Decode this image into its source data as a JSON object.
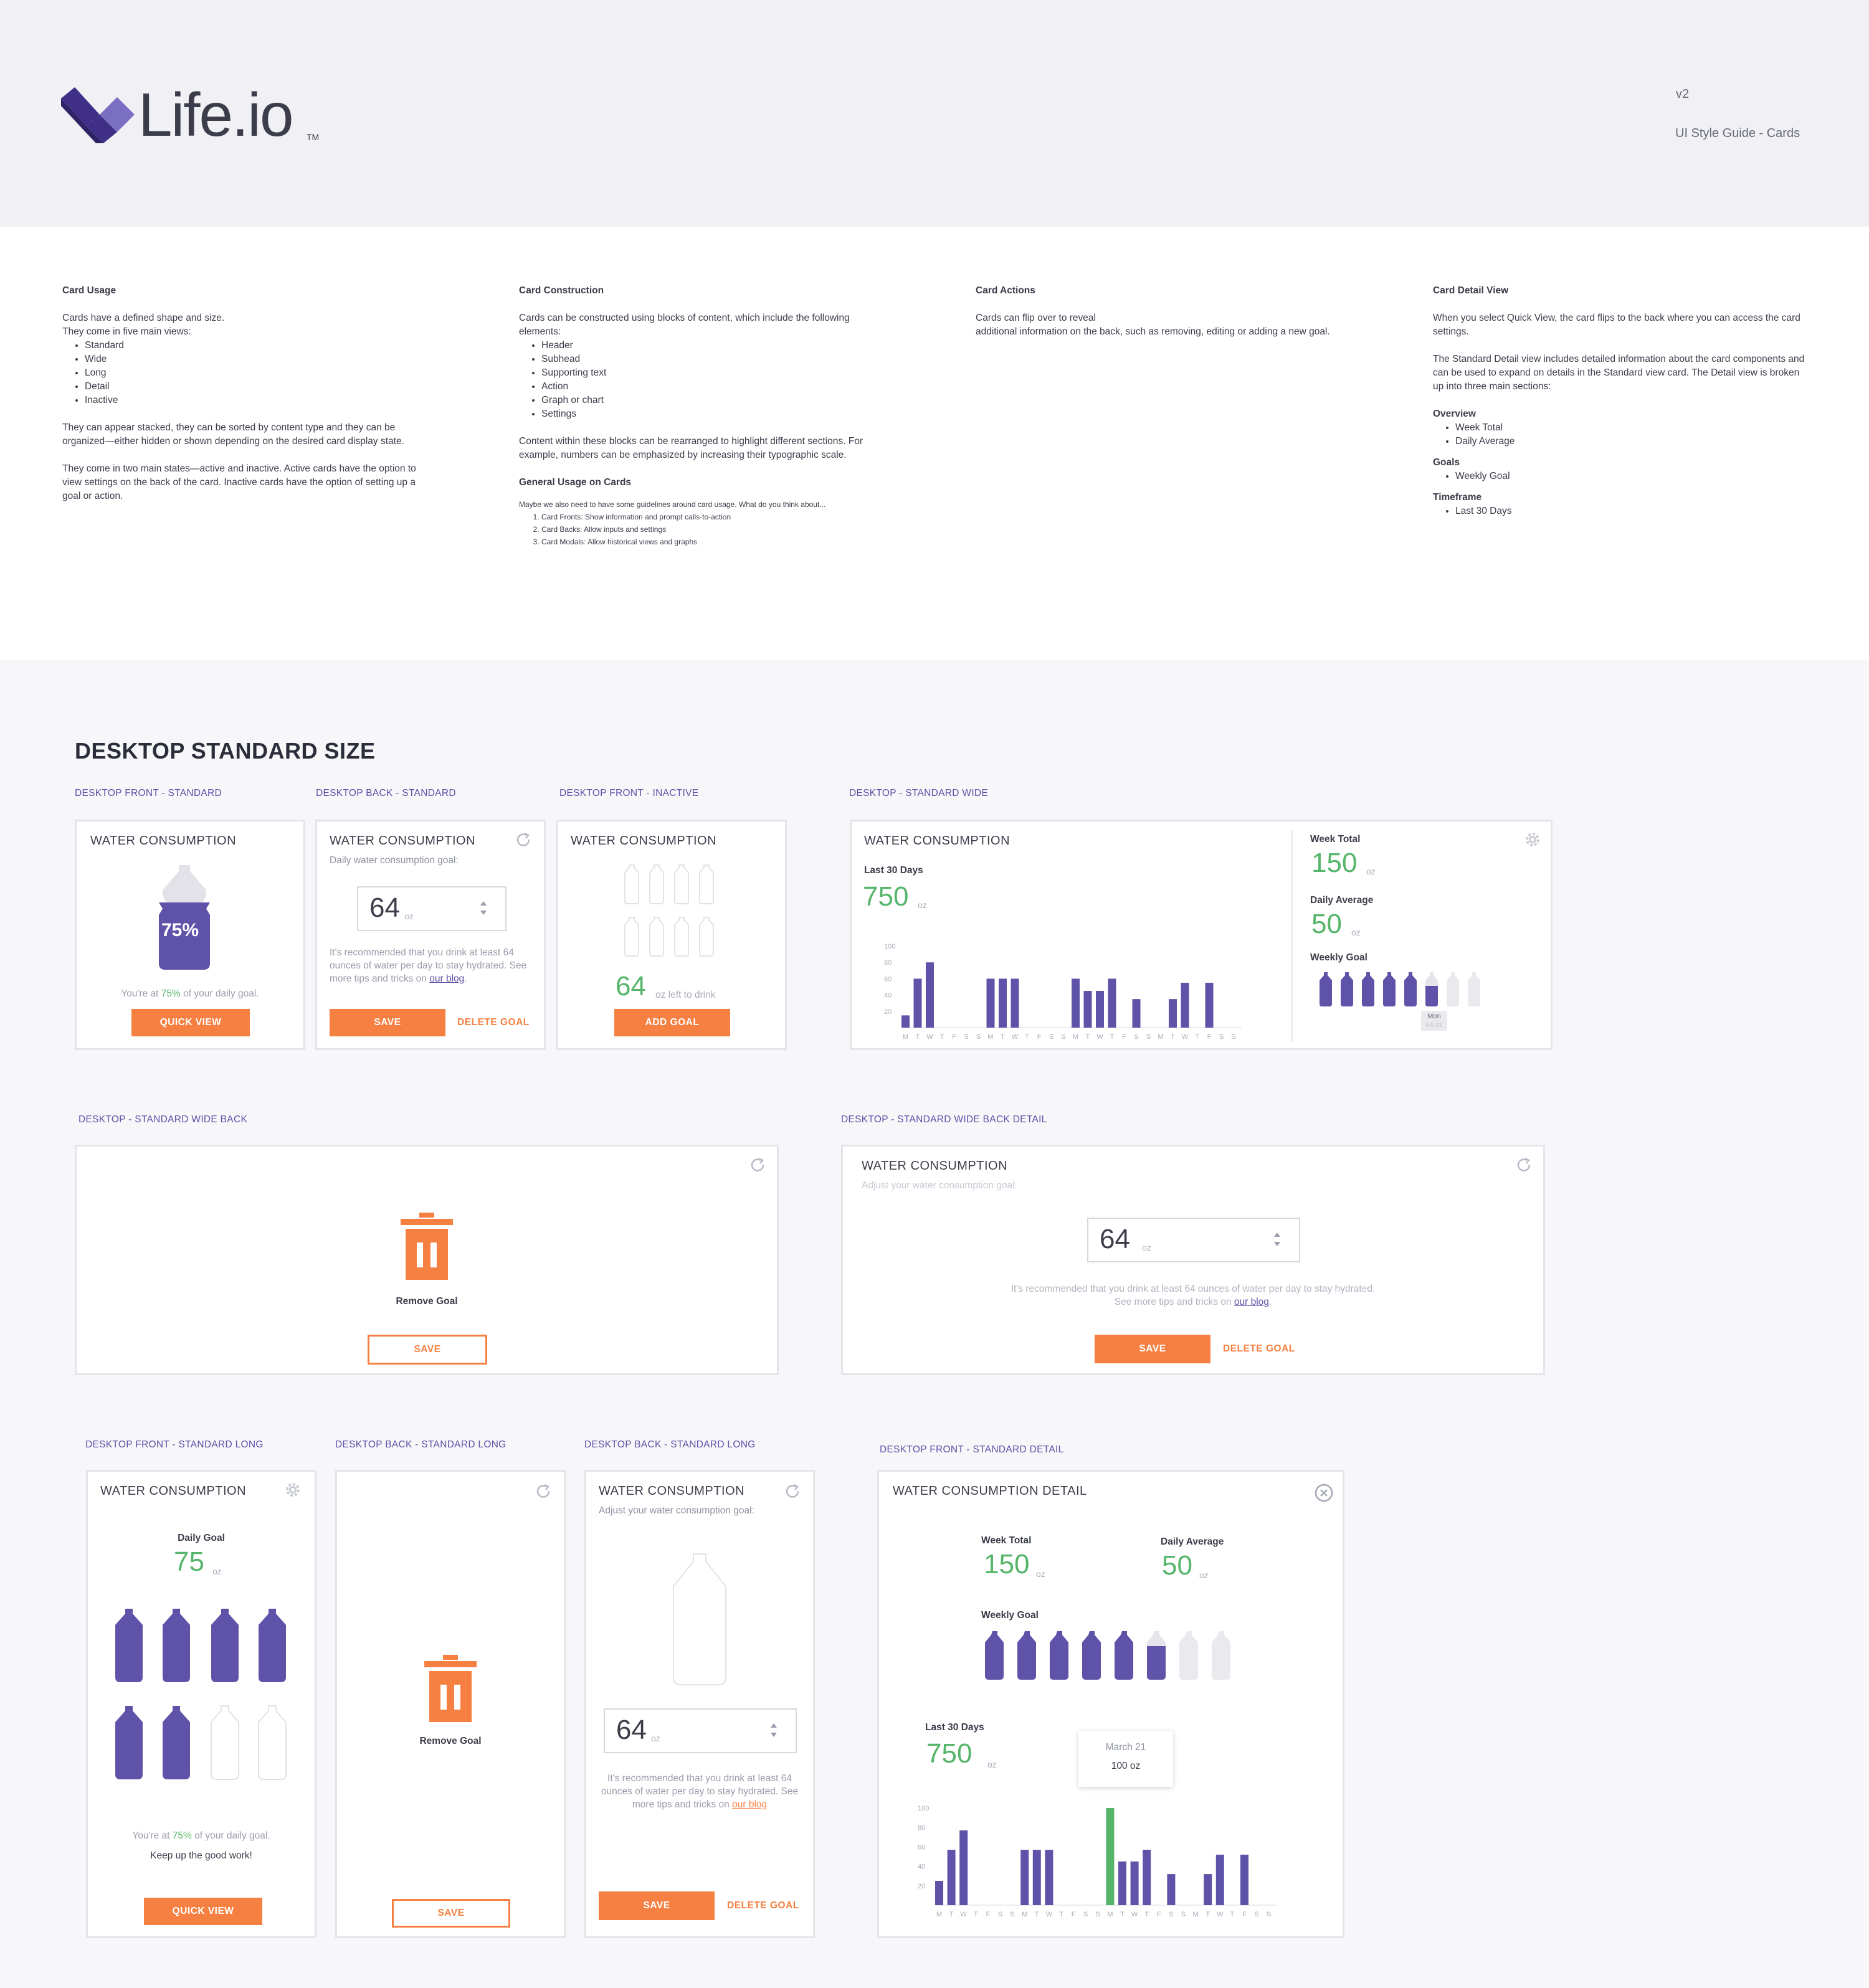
{
  "header": {
    "logo_text": "Life.io",
    "logo_tm": "TM",
    "version": "v2",
    "guide_title": "UI Style Guide - Cards"
  },
  "notes": {
    "usage": {
      "title": "Card Usage",
      "p1a": "Cards have a defined shape and size.",
      "p1b": "They come in five main views:",
      "views": [
        "Standard",
        "Wide",
        "Long",
        "Detail",
        "Inactive"
      ],
      "p2": "They can appear stacked, they can be sorted by content type and they can be organized—either hidden or shown depending on the desired card display state.",
      "p3": "They come in two main states—active and inactive. Active cards have the option to view settings on the back of the card. Inactive cards have the option of setting up a goal or action."
    },
    "construction": {
      "title": "Card Construction",
      "p1": "Cards can be constructed using blocks of content, which include the following elements:",
      "elements": [
        "Header",
        "Subhead",
        "Supporting text",
        "Action",
        "Graph or chart",
        "Settings"
      ],
      "p2": "Content within these blocks can be rearranged to highlight different sections. For example, numbers can be emphasized by increasing their typographic scale.",
      "general_title": "General Usage on Cards",
      "general_intro": "Maybe we also need to have some guidelines around card usage. What do you think about...",
      "general_items": [
        "Card Fronts: Show information and prompt calls-to-action",
        "Card Backs: Allow inputs and settings",
        "Card Modals: Allow historical views and graphs"
      ]
    },
    "actions": {
      "title": "Card Actions",
      "p1a": "Cards can flip over to reveal",
      "p1b": "additional information on the back, such as removing, editing or adding a new goal."
    },
    "detail": {
      "title": "Card Detail View",
      "p1": "When you select Quick View, the card flips to the back where you can access the card settings.",
      "p2": "The Standard Detail view includes detailed information about the card components and can be used to expand on details in the Standard view card. The Detail view is broken up into three main sections:",
      "overview_title": "Overview",
      "overview_items": [
        "Week Total",
        "Daily Average"
      ],
      "goals_title": "Goals",
      "goals_items": [
        "Weekly Goal"
      ],
      "timeframe_title": "Timeframe",
      "timeframe_items": [
        "Last 30 Days"
      ]
    }
  },
  "section_title": "DESKTOP STANDARD SIZE",
  "labels": {
    "front_standard": "DESKTOP FRONT - STANDARD",
    "back_standard": "DESKTOP BACK - STANDARD",
    "front_inactive": "DESKTOP FRONT - INACTIVE",
    "standard_wide": "DESKTOP - STANDARD WIDE",
    "wide_back": "DESKTOP - STANDARD WIDE BACK",
    "wide_back_detail": "DESKTOP - STANDARD WIDE BACK DETAIL",
    "front_long": "DESKTOP FRONT - STANDARD LONG",
    "back_long_1": "DESKTOP BACK - STANDARD LONG",
    "back_long_2": "DESKTOP BACK - STANDARD LONG",
    "front_detail": "DESKTOP FRONT - STANDARD DETAIL"
  },
  "common": {
    "card_title": "WATER CONSUMPTION",
    "detail_title": "WATER CONSUMPTION DETAIL",
    "quick_view": "QUICK VIEW",
    "save": "SAVE",
    "delete_goal": "DELETE GOAL",
    "add_goal": "ADD GOAL",
    "remove_goal": "Remove Goal",
    "unit": "oz",
    "goal_value": "64",
    "daily_goal_sub": "Daily water consumption goal:",
    "adjust_goal_sub": "Adjust your water consumption goal:",
    "link_text": "our blog",
    "rec_start": "It's recommended that you drink at least 64 ounces of water per day to stay hydrated. See more tips and tricks on ",
    "rec_wide_line1": "It's recommended that you drink at least 64 ounces of water per day to stay hydrated.",
    "rec_wide_line2": "See more tips and tricks on "
  },
  "front_standard": {
    "percent": "75%",
    "status_pre": "You're at ",
    "status_pct": "75%",
    "status_post": " of your daily goal."
  },
  "inactive": {
    "value": "64",
    "left_text": "oz left to drink"
  },
  "wide": {
    "last30_label": "Last 30 Days",
    "last30_value": "750",
    "week_total_label": "Week Total",
    "week_total_value": "150",
    "daily_avg_label": "Daily Average",
    "daily_avg_value": "50",
    "weekly_goal_label": "Weekly Goal",
    "tooltip_day": "Mon",
    "tooltip_value": "64 oz"
  },
  "long_front": {
    "daily_goal_label": "Daily Goal",
    "daily_goal_value": "75",
    "status_pre": "You're at ",
    "status_pct": "75%",
    "status_post": " of your daily goal.",
    "encourage": "Keep up the good work!"
  },
  "detail_card": {
    "week_total_label": "Week Total",
    "week_total_value": "150",
    "daily_avg_label": "Daily Average",
    "daily_avg_value": "50",
    "weekly_goal_label": "Weekly Goal",
    "last30_label": "Last 30 Days",
    "last30_value": "750",
    "tooltip_date": "March 21",
    "tooltip_value": "100 oz"
  },
  "chart_data": [
    {
      "type": "bar",
      "title": "Last 30 Days",
      "ylim": [
        0,
        100
      ],
      "yticks": [
        20,
        40,
        60,
        80,
        100
      ],
      "categories": [
        "M",
        "T",
        "W",
        "T",
        "F",
        "S",
        "S",
        "M",
        "T",
        "W",
        "T",
        "F",
        "S",
        "S",
        "M",
        "T",
        "W",
        "T",
        "F",
        "S",
        "S",
        "M",
        "T",
        "W",
        "T",
        "F",
        "S",
        "S"
      ],
      "values": [
        15,
        60,
        80,
        0,
        0,
        0,
        0,
        60,
        60,
        60,
        0,
        0,
        0,
        0,
        60,
        45,
        45,
        60,
        0,
        35,
        0,
        0,
        35,
        55,
        0,
        55,
        0,
        0
      ],
      "grid": false
    },
    {
      "type": "bar",
      "title": "Last 30 Days",
      "ylim": [
        0,
        100
      ],
      "yticks": [
        20,
        40,
        60,
        80,
        100
      ],
      "categories": [
        "M",
        "T",
        "W",
        "T",
        "F",
        "S",
        "S",
        "M",
        "T",
        "W",
        "T",
        "F",
        "S",
        "S",
        "M",
        "T",
        "W",
        "T",
        "F",
        "S",
        "S",
        "M",
        "T",
        "W",
        "T",
        "F",
        "S",
        "S"
      ],
      "values": [
        25,
        57,
        77,
        0,
        0,
        0,
        0,
        57,
        57,
        57,
        0,
        0,
        0,
        0,
        100,
        45,
        45,
        57,
        0,
        32,
        0,
        0,
        32,
        52,
        0,
        52,
        0,
        0
      ],
      "highlight_index": 14,
      "grid": false
    }
  ],
  "colors": {
    "purple": "#5e53a8",
    "orange": "#f58041",
    "green": "#56b56a",
    "label_purple": "#5b51a8"
  }
}
